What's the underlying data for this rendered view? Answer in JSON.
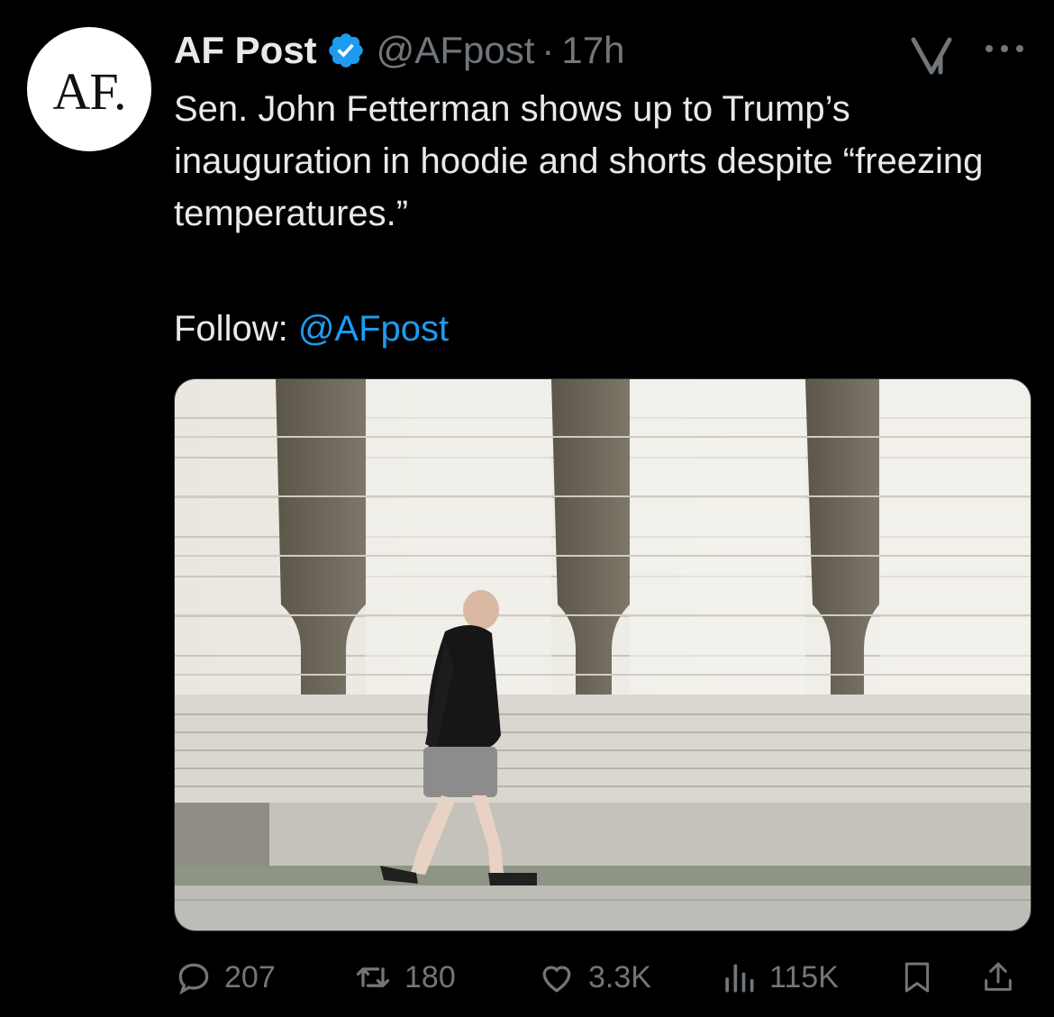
{
  "author": {
    "avatar_text": "AF.",
    "name": "AF Post",
    "handle": "@AFpost",
    "separator": "·",
    "time": "17h"
  },
  "post": {
    "text": "Sen. John Fetterman shows up to Trump’s inauguration in hoodie and shorts despite “freezing temperatures.”",
    "follow_label": "Follow: ",
    "follow_link": "@AFpost"
  },
  "actions": {
    "replies": "207",
    "reposts": "180",
    "likes": "3.3K",
    "views": "115K"
  },
  "icons": {
    "verified": "verified-badge-icon",
    "grok": "grok-icon",
    "more": "more-icon",
    "reply": "reply-icon",
    "repost": "repost-icon",
    "like": "like-icon",
    "views": "views-icon",
    "bookmark": "bookmark-icon",
    "share": "share-icon"
  },
  "colors": {
    "background": "#000000",
    "text": "#e7e9ea",
    "secondary": "#71767b",
    "link": "#1d9bf0"
  }
}
